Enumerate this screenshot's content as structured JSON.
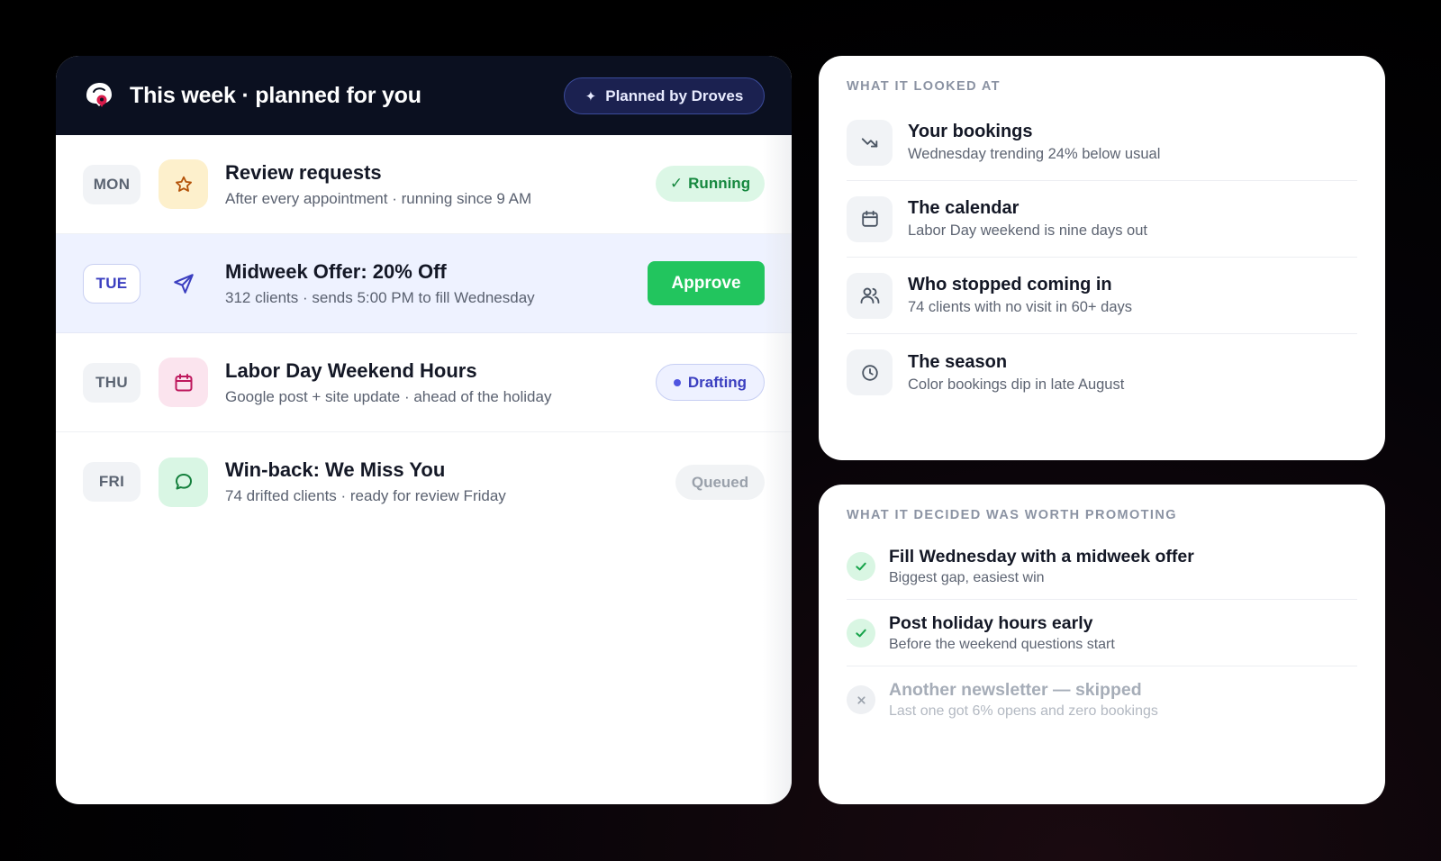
{
  "plan": {
    "title": "This week · planned for you",
    "badge": "Planned by Droves",
    "tasks": [
      {
        "day": "MON",
        "title": "Review requests",
        "subtitle": "After every appointment · running since 9 AM",
        "icon": "star-icon",
        "status": "Running"
      },
      {
        "day": "TUE",
        "title": "Midweek Offer: 20% Off",
        "subtitle": "312 clients · sends 5:00 PM to fill Wednesday",
        "icon": "send-icon",
        "status": "Approve"
      },
      {
        "day": "THU",
        "title": "Labor Day Weekend Hours",
        "subtitle": "Google post + site update · ahead of the holiday",
        "icon": "calendar-icon",
        "status": "Drafting"
      },
      {
        "day": "FRI",
        "title": "Win-back: We Miss You",
        "subtitle": "74 drifted clients · ready for review Friday",
        "icon": "chat-icon",
        "status": "Queued"
      }
    ]
  },
  "looked_at": {
    "label": "WHAT IT LOOKED AT",
    "items": [
      {
        "title": "Your bookings",
        "subtitle": "Wednesday trending 24% below usual",
        "icon": "trending-down-icon"
      },
      {
        "title": "The calendar",
        "subtitle": "Labor Day weekend is nine days out",
        "icon": "calendar-icon"
      },
      {
        "title": "Who stopped coming in",
        "subtitle": "74 clients with no visit in 60+ days",
        "icon": "users-icon"
      },
      {
        "title": "The season",
        "subtitle": "Color bookings dip in late August",
        "icon": "clock-icon"
      }
    ]
  },
  "decided": {
    "label": "WHAT IT DECIDED WAS WORTH PROMOTING",
    "items": [
      {
        "title": "Fill Wednesday with a midweek offer",
        "subtitle": "Biggest gap, easiest win",
        "icon": "check-icon"
      },
      {
        "title": "Post holiday hours early",
        "subtitle": "Before the weekend questions start",
        "icon": "check-icon"
      },
      {
        "title": "Another newsletter — skipped",
        "subtitle": "Last one got 6% opens and zero bookings",
        "icon": "x-icon"
      }
    ]
  },
  "colors": {
    "header_bg": "#0b1020",
    "approve_green": "#22c55e",
    "active_row": "#eef2ff",
    "brand_indigo": "#3b3fc0"
  }
}
